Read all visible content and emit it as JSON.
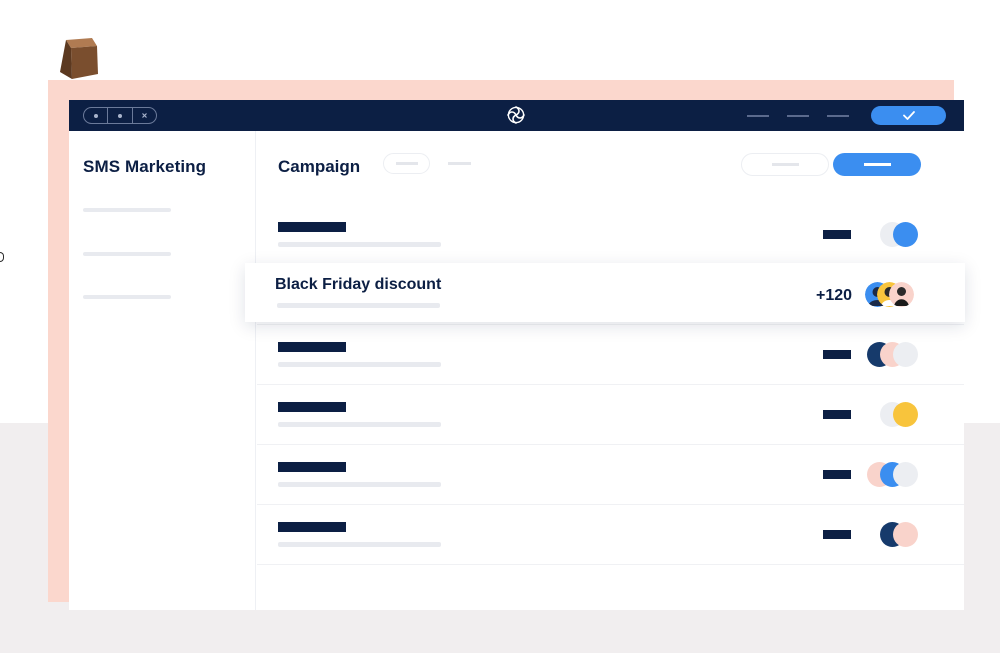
{
  "sidebar": {
    "title": "SMS Marketing"
  },
  "main": {
    "title": "Campaign"
  },
  "highlighted_row": {
    "title": "Black Friday discount",
    "count": "+120"
  },
  "icons": {
    "logo": "sendinblue-swirl-icon",
    "confirm": "check-icon"
  },
  "colors": {
    "navy": "#0c1f44",
    "accent_blue": "#3b8ef0",
    "pink_backdrop": "#fbd7cd",
    "yellow_toggle": "#f8c43c"
  }
}
